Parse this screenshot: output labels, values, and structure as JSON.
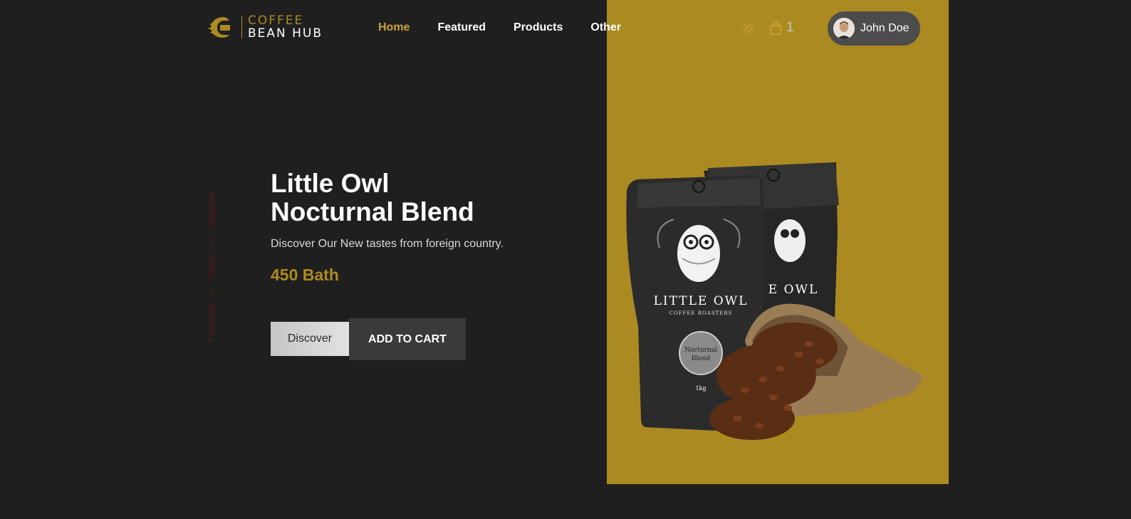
{
  "brand": {
    "line1": "COFFEE",
    "line2": "BEAN HUB",
    "accent": "#ac8a22",
    "icon": "coffee-bean-logo"
  },
  "nav": {
    "items": [
      {
        "label": "Home",
        "active": true
      },
      {
        "label": "Featured",
        "active": false
      },
      {
        "label": "Products",
        "active": false
      },
      {
        "label": "Other",
        "active": false
      }
    ]
  },
  "header": {
    "theme_icon": "sun-icon",
    "cart_icon": "shopping-bag-icon",
    "cart_count": "1"
  },
  "user": {
    "name": "John Doe"
  },
  "social": {
    "items": [
      "Instagram",
      "Twitter",
      "Facebook"
    ]
  },
  "hero": {
    "title_line1": "Little Owl",
    "title_line2": "Nocturnal Blend",
    "subtitle": "Discover Our New tastes from foreign country.",
    "price": "450 Bath",
    "discover_label": "Discover",
    "add_to_cart_label": "ADD TO CART"
  },
  "product_image": {
    "bag_brand": "LITTLE OWL",
    "bag_sub": "COFFEE ROASTERS",
    "label_line1": "Nocturnal",
    "label_line2": "Blend",
    "weight": "1kg"
  },
  "colors": {
    "background": "#1f1f1f",
    "panel": "#ac8a22",
    "nav_active": "#c9a431"
  }
}
